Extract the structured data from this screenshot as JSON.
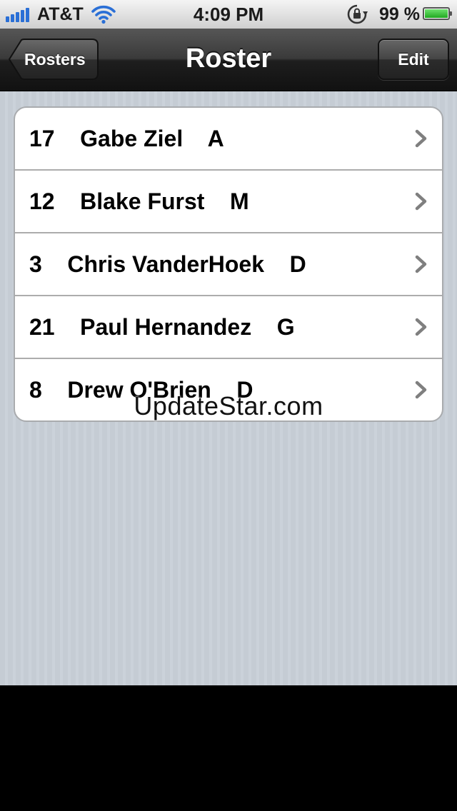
{
  "status_bar": {
    "carrier": "AT&T",
    "time": "4:09 PM",
    "battery_percent": "99 %",
    "battery_level": 0.99,
    "icons": [
      "signal-icon",
      "wifi-icon",
      "rotation-lock-icon",
      "battery-icon"
    ]
  },
  "nav_bar": {
    "back_label": "Rosters",
    "title": "Roster",
    "edit_label": "Edit"
  },
  "roster": {
    "rows": [
      {
        "label": "17    Gabe Ziel    A"
      },
      {
        "label": "12    Blake Furst    M"
      },
      {
        "label": "3    Chris VanderHoek    D"
      },
      {
        "label": "21    Paul Hernandez    G"
      },
      {
        "label": "8    Drew O'Brien    D"
      }
    ]
  },
  "watermark": "UpdateStar.com",
  "colors": {
    "background_stripe_1": "#c5ccd4",
    "background_stripe_2": "#cbd2da",
    "signal_blue": "#2a6fd6",
    "battery_green": "#1fa81f",
    "chevron_gray": "#7f7f7f"
  }
}
